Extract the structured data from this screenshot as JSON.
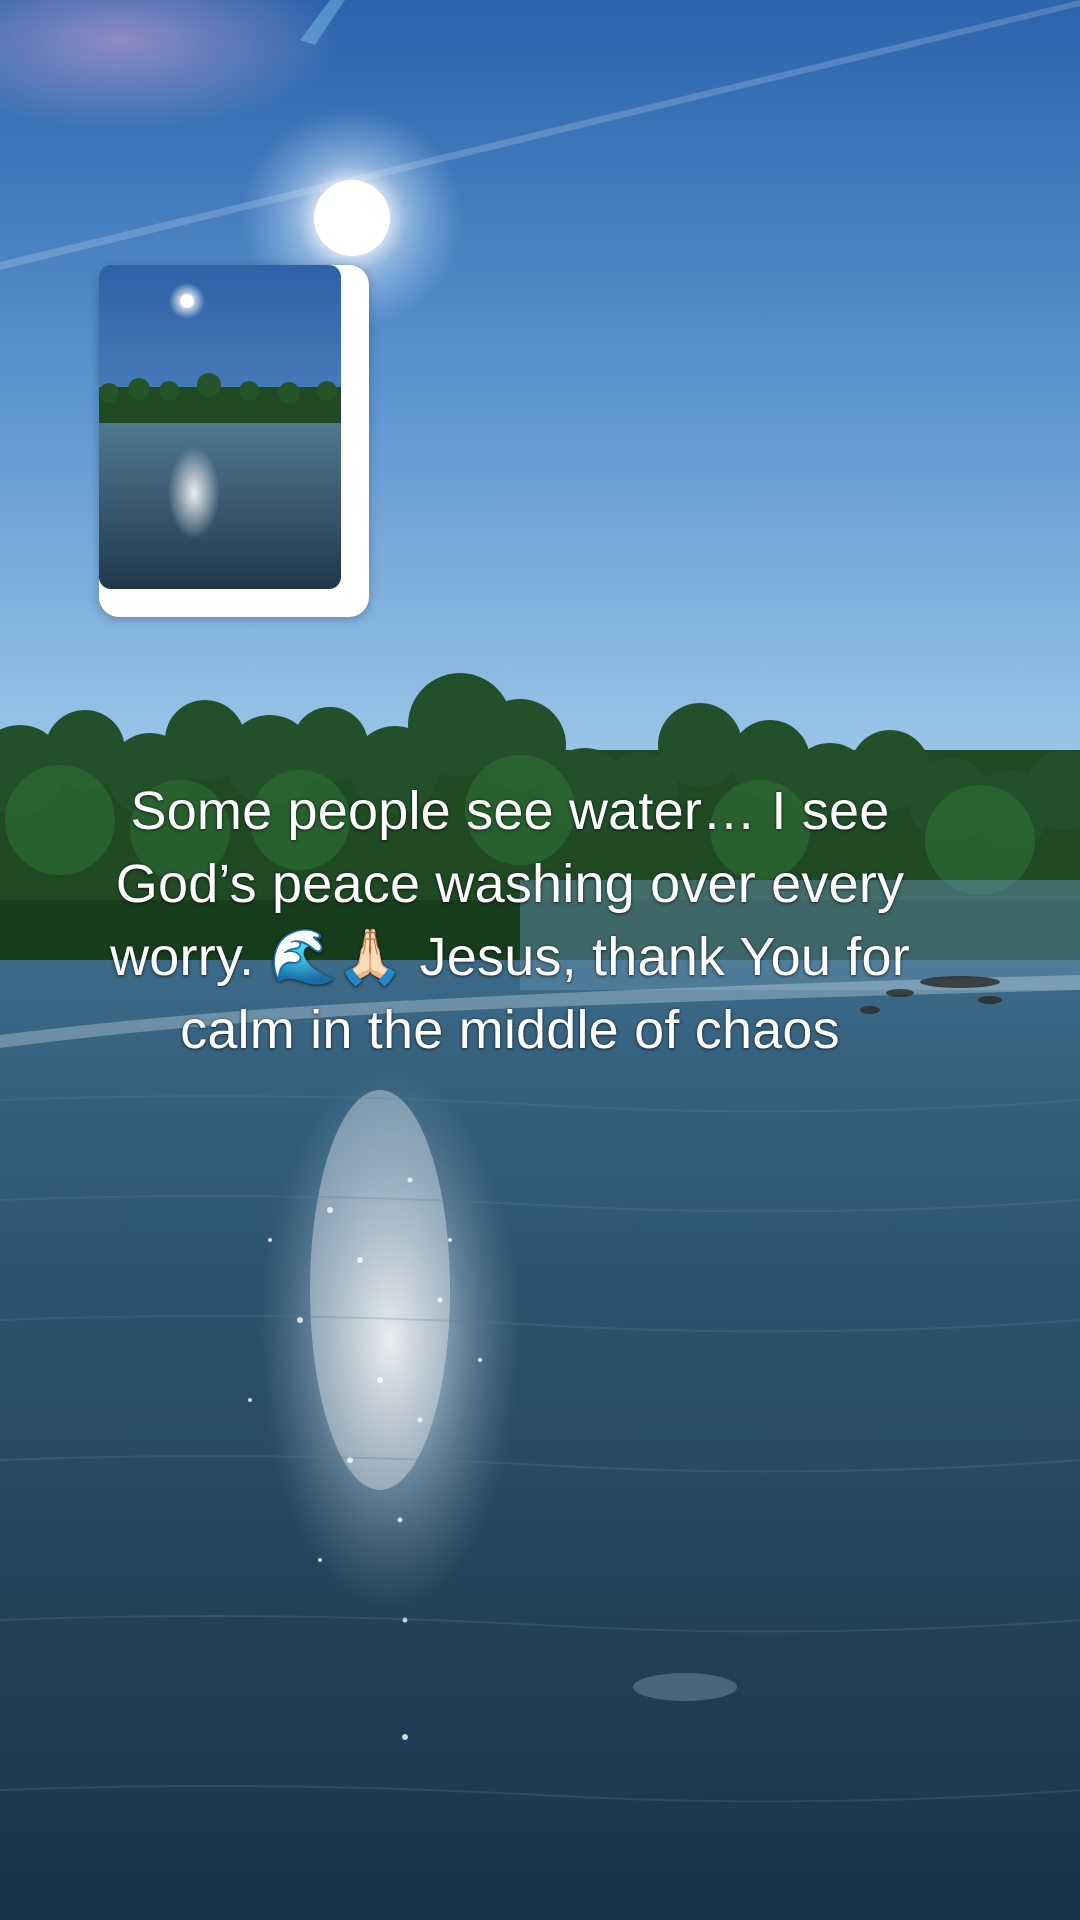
{
  "overlay": {
    "caption": "Some people see water… I see God’s peace washing over every worry. 🌊🙏🏻 Jesus, thank You for calm in the middle of chaos"
  },
  "colors": {
    "sky_top": "#2a66b0",
    "sky_bottom": "#8fbde3",
    "trees": "#1f4a22",
    "water": "#24455e",
    "thumb_border": "#ffffff",
    "caption_text": "#ffffff"
  },
  "icons": {
    "thumbnail": "photo-thumbnail"
  }
}
